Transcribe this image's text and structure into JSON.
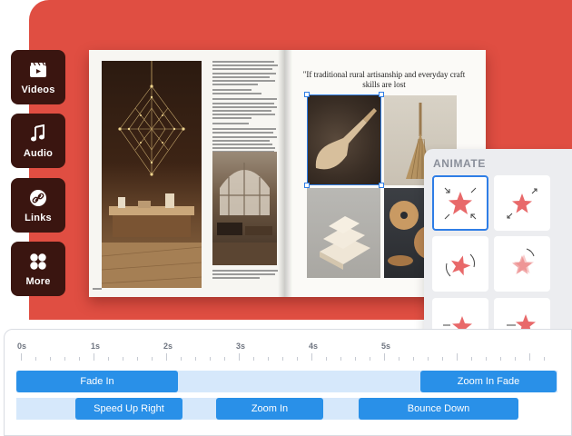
{
  "sidebar": {
    "items": [
      {
        "label": "Videos",
        "icon": "film-icon"
      },
      {
        "label": "Audio",
        "icon": "music-note-icon"
      },
      {
        "label": "Links",
        "icon": "link-icon"
      },
      {
        "label": "More",
        "icon": "grid-icon"
      }
    ]
  },
  "book": {
    "quote": "\"If traditional rural artisanship and everyday craft skills are lost"
  },
  "animate": {
    "title": "ANIMATE",
    "tiles": [
      {
        "icon": "star-zoom-in-icon",
        "selected": true
      },
      {
        "icon": "star-zoom-out-icon",
        "selected": false
      },
      {
        "icon": "star-rotate-icon",
        "selected": false
      },
      {
        "icon": "star-blur-icon",
        "selected": false
      },
      {
        "icon": "star-speed-left-icon",
        "selected": false
      },
      {
        "icon": "star-speed-right-icon",
        "selected": false
      }
    ]
  },
  "timeline": {
    "ticks": [
      "0s",
      "1s",
      "2s",
      "3s",
      "4s",
      "5s"
    ],
    "track1": {
      "clips": [
        "Fade In",
        "Zoom In Fade"
      ]
    },
    "track2": {
      "clips": [
        "Speed Up Right",
        "Zoom In",
        "Bounce Down"
      ]
    }
  },
  "colors": {
    "accent": "#2990e8",
    "background_red": "#e04e42",
    "sidebar": "#3a1510",
    "star": "#e8696a"
  }
}
